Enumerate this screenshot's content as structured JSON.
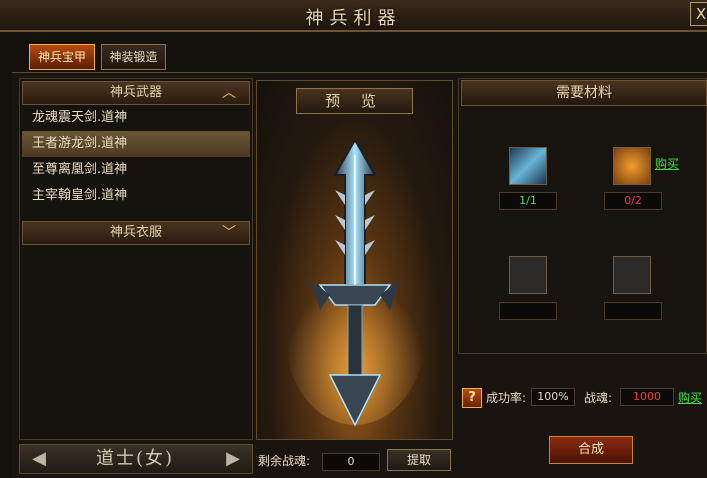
{
  "window": {
    "title": "神兵利器",
    "close_label": "X"
  },
  "tabs": [
    {
      "label": "神兵宝甲",
      "active": true
    },
    {
      "label": "神装锻造",
      "active": false
    }
  ],
  "left_panel": {
    "weapons_header": "神兵武器",
    "weapons": [
      "龙魂震天剑.道神",
      "王者游龙剑.道神",
      "至尊离凰剑.道神",
      "主宰翰皇剑.道神"
    ],
    "selected_index": 1,
    "clothes_header": "神兵衣服",
    "class_label": "道士(女)"
  },
  "preview": {
    "title": "预 览",
    "remain_label": "剩余战魂:",
    "remain_value": "0",
    "extract_label": "提取"
  },
  "materials": {
    "title": "需要材料",
    "slots": [
      {
        "icon": "sword-material-icon",
        "count": "1/1"
      },
      {
        "icon": "scroll-material-icon",
        "count": "0/2"
      },
      {
        "icon": "empty-slot",
        "count": ""
      },
      {
        "icon": "empty-slot",
        "count": ""
      }
    ],
    "buy_label": "购买",
    "success_rate_label": "成功率:",
    "success_rate_value": "100%",
    "soul_label": "战魂:",
    "soul_value": "1000",
    "combine_label": "合成",
    "help_label": "?"
  },
  "colors": {
    "ok": "#4ee24e",
    "missing": "#ff3b3b",
    "accent": "#f0c04a"
  }
}
